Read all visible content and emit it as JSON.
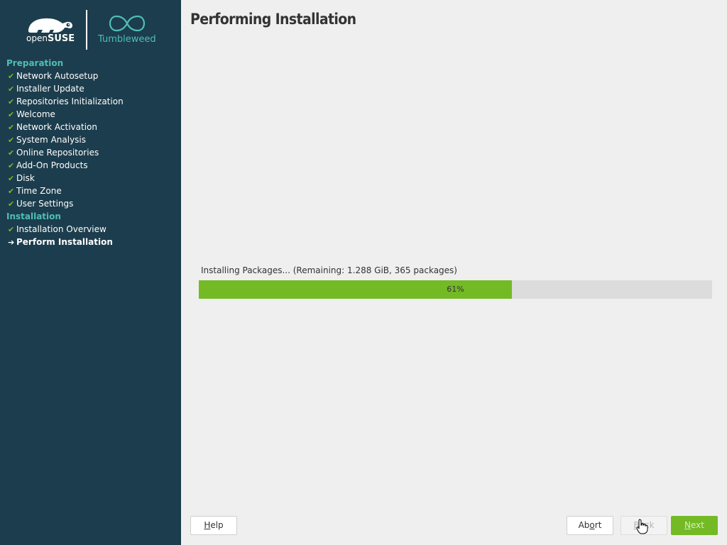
{
  "branding": {
    "distro_light": "open",
    "distro_bold": "SUSE",
    "edition": "Tumbleweed",
    "accent": "#73ba25",
    "teal": "#4fbfb3",
    "sidebar_bg": "#1c3d4d"
  },
  "sidebar": {
    "preparation_title": "Preparation",
    "preparation_steps": [
      {
        "label": "Network Autosetup",
        "mark": "✔"
      },
      {
        "label": "Installer Update",
        "mark": "✔"
      },
      {
        "label": "Repositories Initialization",
        "mark": "✔"
      },
      {
        "label": "Welcome",
        "mark": "✔"
      },
      {
        "label": "Network Activation",
        "mark": "✔"
      },
      {
        "label": "System Analysis",
        "mark": "✔"
      },
      {
        "label": "Online Repositories",
        "mark": "✔"
      },
      {
        "label": "Add-On Products",
        "mark": "✔"
      },
      {
        "label": "Disk",
        "mark": "✔"
      },
      {
        "label": "Time Zone",
        "mark": "✔"
      },
      {
        "label": "User Settings",
        "mark": "✔"
      }
    ],
    "installation_title": "Installation",
    "installation_steps": [
      {
        "label": "Installation Overview",
        "mark": "✔"
      },
      {
        "label": "Perform Installation",
        "mark": "➔"
      }
    ]
  },
  "main": {
    "title": "Performing Installation",
    "progress_label": "Installing Packages... (Remaining: 1.288 GiB, 365 packages)",
    "progress_value": 61,
    "progress_text": "61%"
  },
  "buttons": {
    "help_label": "Help",
    "abort_label": "Abort",
    "back_label": "Back",
    "next_label": "Next"
  }
}
